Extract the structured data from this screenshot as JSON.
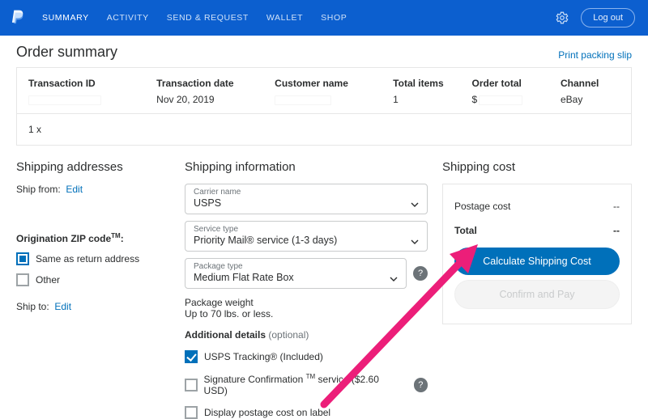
{
  "nav": {
    "items": [
      "SUMMARY",
      "ACTIVITY",
      "SEND & REQUEST",
      "WALLET",
      "SHOP"
    ],
    "logout": "Log out"
  },
  "page": {
    "title": "Order summary",
    "packing_link": "Print packing slip"
  },
  "summary": {
    "headers": {
      "tid": "Transaction ID",
      "date": "Transaction date",
      "name": "Customer name",
      "items": "Total items",
      "total": "Order total",
      "channel": "Channel"
    },
    "values": {
      "date": "Nov 20, 2019",
      "items": "1",
      "total_prefix": "$",
      "channel": "eBay"
    },
    "line_item_qty": "1  x"
  },
  "shipping_addr": {
    "title": "Shipping addresses",
    "ship_from_label": "Ship from:",
    "edit": "Edit",
    "zip_label_html": "Origination ZIP code",
    "zip_tm": "TM",
    "opt_same": "Same as return address",
    "opt_other": "Other",
    "ship_to_label": "Ship to:"
  },
  "shipping_info": {
    "title": "Shipping information",
    "carrier_label": "Carrier name",
    "carrier_value": "USPS",
    "service_label": "Service type",
    "service_value": "Priority Mail® service (1-3 days)",
    "package_label": "Package type",
    "package_value": "Medium Flat Rate Box",
    "weight_label": "Package weight",
    "weight_note": "Up to 70 lbs. or less.",
    "additional_label": "Additional details",
    "additional_optional": "(optional)",
    "tracking_label": "USPS Tracking® (Included)",
    "sig_prefix": "Signature Confirmation ",
    "sig_tm": "TM",
    "sig_suffix": " service ($2.60 USD)",
    "display_postage_label": "Display postage cost on label"
  },
  "cost": {
    "title": "Shipping cost",
    "postage_label": "Postage cost",
    "postage_value": "--",
    "total_label": "Total",
    "total_value": "--",
    "calc_btn": "Calculate Shipping Cost",
    "confirm_btn": "Confirm and Pay"
  }
}
